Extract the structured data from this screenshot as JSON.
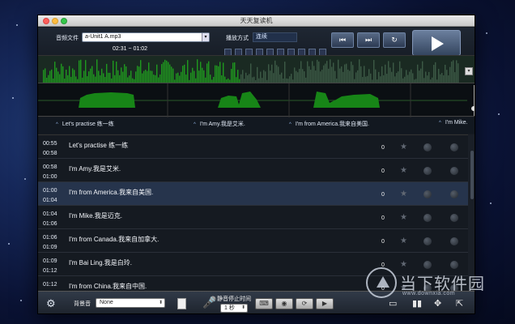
{
  "window": {
    "title": "天天复读机"
  },
  "top": {
    "file_label": "音频文件",
    "file_value": "a-Unit1 A.mp3",
    "time_range": "02:31 ~ 01:02",
    "mode_label": "播放方式",
    "mode_value": "连续",
    "transport": {
      "prev": "⏮",
      "next": "⏭",
      "repeat": "↻"
    }
  },
  "markers": [
    {
      "label": "Let's practise 练一练"
    },
    {
      "label": "I'm Amy.我是艾米."
    },
    {
      "label": "I'm from America.我来自美国."
    },
    {
      "label": "I'm Mike."
    }
  ],
  "rows": [
    {
      "start": "00:55",
      "end": "00:58",
      "sentence": "Let's practise 练一练",
      "count": "0",
      "selected": false
    },
    {
      "start": "00:58",
      "end": "01:00",
      "sentence": "I'm Amy.我是艾米.",
      "count": "0",
      "selected": false
    },
    {
      "start": "01:00",
      "end": "01:04",
      "sentence": "I'm from America.我来自美国.",
      "count": "0",
      "selected": true
    },
    {
      "start": "01:04",
      "end": "01:06",
      "sentence": "I'm Mike.我是迈克.",
      "count": "0",
      "selected": false
    },
    {
      "start": "01:06",
      "end": "01:09",
      "sentence": "I'm from Canada.我来自加拿大.",
      "count": "0",
      "selected": false
    },
    {
      "start": "01:09",
      "end": "01:12",
      "sentence": "I'm Bai Ling.我是白玲.",
      "count": "0",
      "selected": false
    },
    {
      "start": "01:12",
      "end": "",
      "sentence": "I'm from China.我来自中国.",
      "count": "0",
      "selected": false
    }
  ],
  "bottom": {
    "bg_label": "背景音",
    "bg_value": "None",
    "silence_label": "静音停止时间",
    "silence_value": "1 秒"
  },
  "watermark": {
    "name": "当下软件园",
    "sub": "www.downxia.com"
  },
  "colors": {
    "waveform": "#1a8a1a",
    "selected_row": "#26344c",
    "mic": "#f28a1e"
  }
}
